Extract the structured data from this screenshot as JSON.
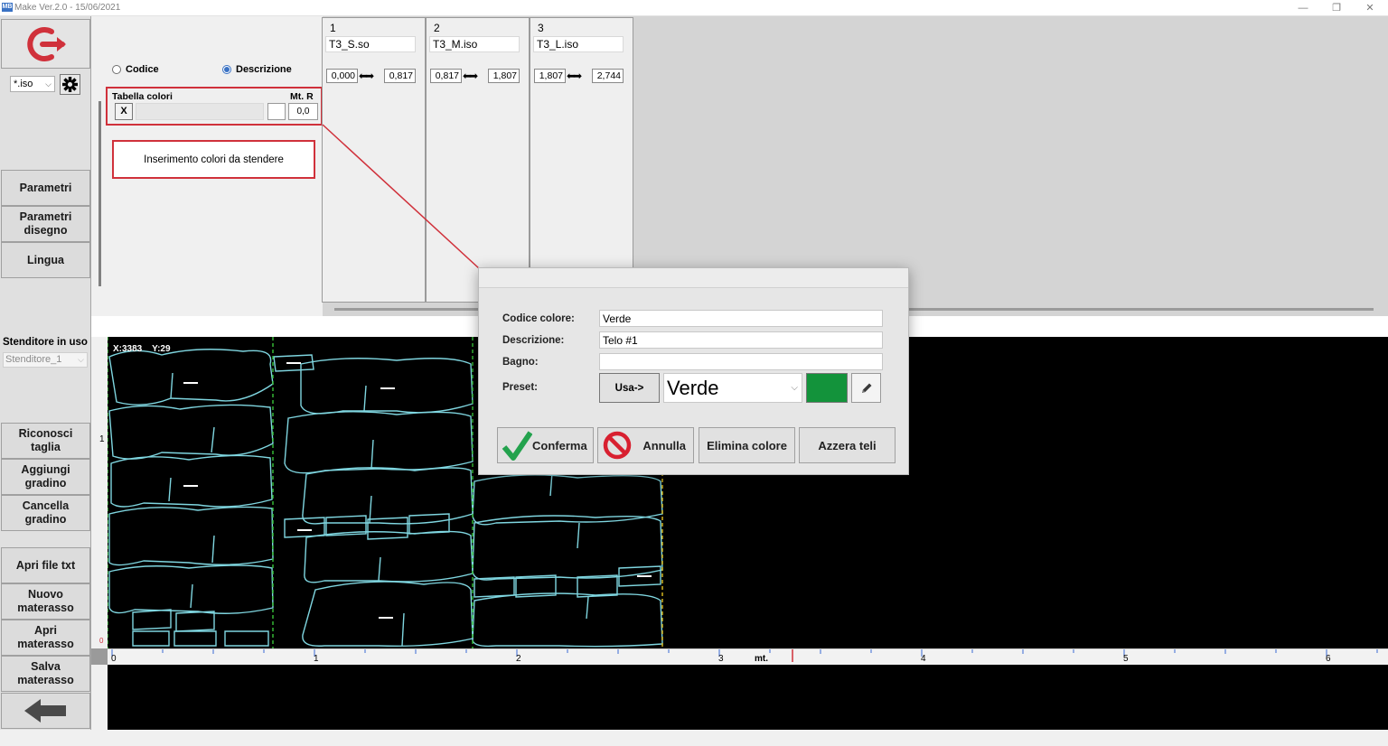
{
  "window": {
    "logo_text": "MB",
    "title": "Make  Ver.2.0 - 15/06/2021",
    "minimize": "—",
    "restore": "❐",
    "close": "✕"
  },
  "left_panel": {
    "format_select": "*.iso",
    "buttons": {
      "parametri": "Parametri",
      "parametri_disegno": "Parametri disegno",
      "lingua": "Lingua",
      "riconosci_taglia": "Riconosci taglia",
      "aggiungi_gradino": "Aggiungi gradino",
      "cancella_gradino": "Cancella gradino",
      "apri_file_txt": "Apri file txt",
      "nuovo_materasso": "Nuovo materasso",
      "apri_materasso": "Apri materasso",
      "salva_materasso": "Salva materasso"
    },
    "stenditore_label": "Stenditore in uso",
    "stenditore_value": "Stenditore_1"
  },
  "options": {
    "codice": "Codice",
    "descrizione": "Descrizione",
    "selected": "descrizione"
  },
  "color_table": {
    "title": "Tabella colori",
    "mtr_label": "Mt. R",
    "x_button": "X",
    "mtr_value": "0,0"
  },
  "annotation": "Inserimento colori da stendere",
  "size_columns": [
    {
      "num": "1",
      "file": "T3_S.so",
      "from": "0,000",
      "to": "0,817"
    },
    {
      "num": "2",
      "file": "T3_M.iso",
      "from": "0,817",
      "to": "1,807"
    },
    {
      "num": "3",
      "file": "T3_L.iso",
      "from": "1,807",
      "to": "2,744"
    }
  ],
  "canvas": {
    "coords": "X:3383    Y:29",
    "left_tick": "1",
    "bottom_tick": "0"
  },
  "ruler": {
    "labels": [
      "0",
      "1",
      "2",
      "3",
      "4",
      "5",
      "6"
    ],
    "unit": "mt."
  },
  "dialog": {
    "codice_label": "Codice colore:",
    "codice_value": "Verde",
    "descrizione_label": "Descrizione:",
    "descrizione_value": "Telo #1",
    "bagno_label": "Bagno:",
    "bagno_value": "",
    "preset_label": "Preset:",
    "usa_button": "Usa->",
    "preset_value": "Verde",
    "preset_color": "#13933b",
    "conferma": "Conferma",
    "annulla": "Annulla",
    "elimina": "Elimina colore",
    "azzera": "Azzera teli"
  },
  "colors": {
    "accent_red": "#d0313b",
    "piece_outline": "#7fd6e0",
    "divider_green": "#38c238",
    "divider_yellow": "#e0c020"
  }
}
